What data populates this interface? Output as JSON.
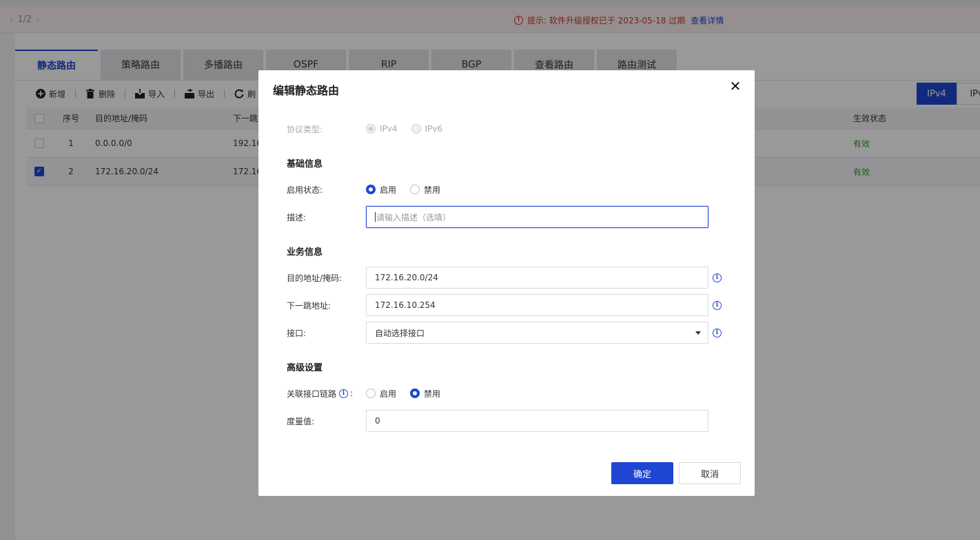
{
  "topbar": {
    "pager": "1/2",
    "notice_text": "提示: 软件升级授权已于 2023-05-18 过期",
    "notice_link": "查看详情"
  },
  "tabs": [
    {
      "label": "静态路由",
      "active": true
    },
    {
      "label": "策略路由",
      "active": false
    },
    {
      "label": "多播路由",
      "active": false
    },
    {
      "label": "OSPF",
      "active": false
    },
    {
      "label": "RIP",
      "active": false
    },
    {
      "label": "BGP",
      "active": false
    },
    {
      "label": "查看路由",
      "active": false
    },
    {
      "label": "路由测试",
      "active": false
    }
  ],
  "toolbar": {
    "add": "新增",
    "delete": "删除",
    "import": "导入",
    "export": "导出",
    "refresh": "刷"
  },
  "version_toggle": {
    "ipv4": "IPv4",
    "ipv6": "IPv"
  },
  "table": {
    "headers": {
      "index": "序号",
      "dst": "目的地址/掩码",
      "nexthop": "下一跳",
      "status": "生效状态"
    },
    "rows": [
      {
        "index": "1",
        "dst": "0.0.0.0/0",
        "nexthop": "192.16",
        "status": "有效",
        "checked": false
      },
      {
        "index": "2",
        "dst": "172.16.20.0/24",
        "nexthop": "172.16",
        "status": "有效",
        "checked": true
      }
    ]
  },
  "modal": {
    "title": "编辑静态路由",
    "protocol_label": "协议类型:",
    "protocol_options": [
      "IPv4",
      "IPv6"
    ],
    "protocol_selected": "IPv4",
    "section_basic": "基础信息",
    "enable_label": "启用状态:",
    "enable_options": [
      "启用",
      "禁用"
    ],
    "enable_selected": "启用",
    "desc_label": "描述:",
    "desc_placeholder": "请输入描述（选填）",
    "section_business": "业务信息",
    "dst_label": "目的地址/掩码:",
    "dst_value": "172.16.20.0/24",
    "nexthop_label": "下一跳地址:",
    "nexthop_value": "172.16.10.254",
    "iface_label": "接口:",
    "iface_value": "自动选择接口",
    "section_advanced": "高级设置",
    "link_label": "关联接口链路",
    "link_options": [
      "启用",
      "禁用"
    ],
    "link_selected": "禁用",
    "metric_label": "度量值:",
    "metric_value": "0",
    "confirm": "确定",
    "cancel": "取消"
  },
  "colors": {
    "primary": "#1e46d2",
    "valid": "#2ea121",
    "warning": "#c0392b"
  }
}
